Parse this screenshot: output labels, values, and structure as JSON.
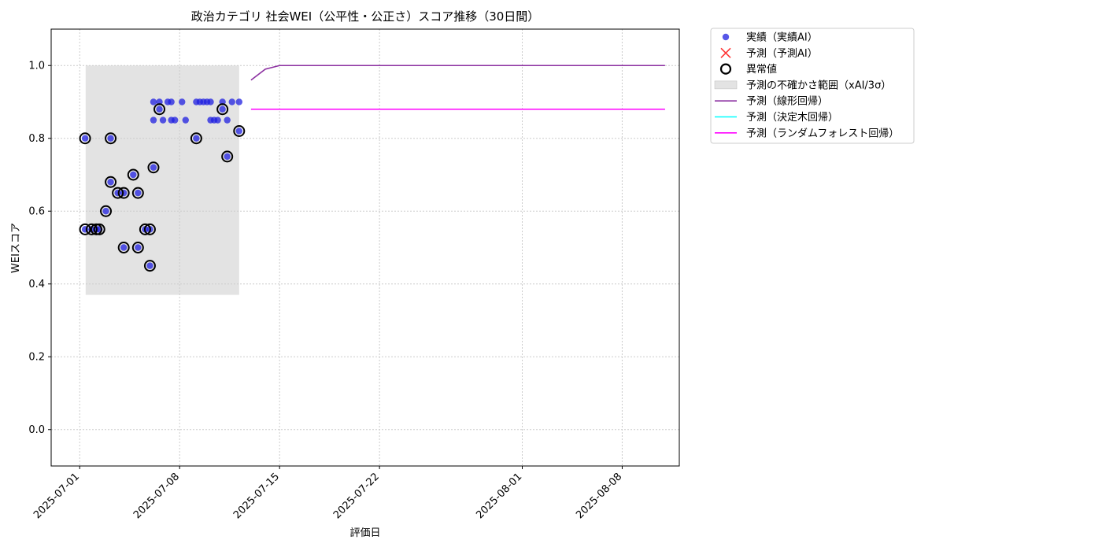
{
  "chart_data": {
    "type": "scatter",
    "title": "政治カテゴリ 社会WEI（公平性・公正さ）スコア推移（30日間）",
    "xlabel": "評価日",
    "ylabel": "WEIスコア",
    "xlim": [
      "2025-06-29",
      "2025-08-12"
    ],
    "ylim": [
      -0.1,
      1.1
    ],
    "x_ticks": [
      "2025-07-01",
      "2025-07-08",
      "2025-07-15",
      "2025-07-22",
      "2025-08-01",
      "2025-08-08"
    ],
    "y_ticks": [
      0.0,
      0.2,
      0.4,
      0.6,
      0.8,
      1.0
    ],
    "y_tick_labels": [
      "0.0",
      "0.2",
      "0.4",
      "0.6",
      "0.8",
      "1.0"
    ],
    "grid": true,
    "legend_position": "outside-upper-right",
    "uncertainty_band": {
      "x_start": "2025-07-01T10:00",
      "x_end": "2025-07-12T04:00",
      "y_low": 0.37,
      "y_high": 1.0,
      "color": "#cccccc"
    },
    "series": [
      {
        "name": "実績（実績AI）",
        "kind": "scatter",
        "color": "#1f1fe0",
        "points": [
          [
            "2025-07-01T09:00",
            0.8
          ],
          [
            "2025-07-01T09:00",
            0.55
          ],
          [
            "2025-07-01T20:00",
            0.55
          ],
          [
            "2025-07-02T04:00",
            0.55
          ],
          [
            "2025-07-02T09:00",
            0.55
          ],
          [
            "2025-07-02T20:00",
            0.6
          ],
          [
            "2025-07-03T04:00",
            0.8
          ],
          [
            "2025-07-03T04:00",
            0.68
          ],
          [
            "2025-07-03T16:00",
            0.65
          ],
          [
            "2025-07-04T02:00",
            0.65
          ],
          [
            "2025-07-04T02:00",
            0.5
          ],
          [
            "2025-07-04T18:00",
            0.7
          ],
          [
            "2025-07-05T02:00",
            0.65
          ],
          [
            "2025-07-05T02:00",
            0.5
          ],
          [
            "2025-07-05T14:00",
            0.55
          ],
          [
            "2025-07-05T22:00",
            0.55
          ],
          [
            "2025-07-05T22:00",
            0.45
          ],
          [
            "2025-07-06T04:00",
            0.72
          ],
          [
            "2025-07-06T04:00",
            0.9
          ],
          [
            "2025-07-06T04:00",
            0.85
          ],
          [
            "2025-07-06T14:00",
            0.88
          ],
          [
            "2025-07-06T14:00",
            0.9
          ],
          [
            "2025-07-06T20:00",
            0.85
          ],
          [
            "2025-07-07T04:00",
            0.9
          ],
          [
            "2025-07-07T10:00",
            0.85
          ],
          [
            "2025-07-07T10:00",
            0.9
          ],
          [
            "2025-07-07T16:00",
            0.85
          ],
          [
            "2025-07-08T04:00",
            0.9
          ],
          [
            "2025-07-08T10:00",
            0.85
          ],
          [
            "2025-07-09T04:00",
            0.9
          ],
          [
            "2025-07-09T04:00",
            0.8
          ],
          [
            "2025-07-09T10:00",
            0.9
          ],
          [
            "2025-07-09T16:00",
            0.9
          ],
          [
            "2025-07-09T22:00",
            0.9
          ],
          [
            "2025-07-10T04:00",
            0.9
          ],
          [
            "2025-07-10T04:00",
            0.85
          ],
          [
            "2025-07-10T10:00",
            0.85
          ],
          [
            "2025-07-10T16:00",
            0.85
          ],
          [
            "2025-07-11T00:00",
            0.88
          ],
          [
            "2025-07-11T00:00",
            0.9
          ],
          [
            "2025-07-11T08:00",
            0.85
          ],
          [
            "2025-07-11T08:00",
            0.75
          ],
          [
            "2025-07-11T16:00",
            0.9
          ],
          [
            "2025-07-12T04:00",
            0.9
          ],
          [
            "2025-07-12T04:00",
            0.82
          ]
        ]
      },
      {
        "name": "予測（予測AI）",
        "kind": "scatter-x",
        "color": "#ff0000",
        "points": []
      },
      {
        "name": "異常値",
        "kind": "ring",
        "color": "#000000",
        "points": [
          [
            "2025-07-01T09:00",
            0.8
          ],
          [
            "2025-07-01T09:00",
            0.55
          ],
          [
            "2025-07-01T20:00",
            0.55
          ],
          [
            "2025-07-02T04:00",
            0.55
          ],
          [
            "2025-07-02T09:00",
            0.55
          ],
          [
            "2025-07-02T20:00",
            0.6
          ],
          [
            "2025-07-03T04:00",
            0.8
          ],
          [
            "2025-07-03T04:00",
            0.68
          ],
          [
            "2025-07-03T16:00",
            0.65
          ],
          [
            "2025-07-04T02:00",
            0.65
          ],
          [
            "2025-07-04T02:00",
            0.5
          ],
          [
            "2025-07-04T18:00",
            0.7
          ],
          [
            "2025-07-05T02:00",
            0.65
          ],
          [
            "2025-07-05T02:00",
            0.5
          ],
          [
            "2025-07-05T14:00",
            0.55
          ],
          [
            "2025-07-05T22:00",
            0.55
          ],
          [
            "2025-07-05T22:00",
            0.45
          ],
          [
            "2025-07-06T04:00",
            0.72
          ],
          [
            "2025-07-06T14:00",
            0.88
          ],
          [
            "2025-07-09T04:00",
            0.8
          ],
          [
            "2025-07-11T00:00",
            0.88
          ],
          [
            "2025-07-11T08:00",
            0.75
          ],
          [
            "2025-07-12T04:00",
            0.82
          ]
        ]
      },
      {
        "name": "予測の不確かさ範囲（xAI/3σ）",
        "kind": "band",
        "color": "#cccccc"
      },
      {
        "name": "予測（線形回帰）",
        "kind": "line",
        "color": "#8b2fa0",
        "points": [
          [
            "2025-07-13",
            0.96
          ],
          [
            "2025-07-14",
            0.99
          ],
          [
            "2025-07-15",
            1.0
          ],
          [
            "2025-08-11",
            1.0
          ]
        ]
      },
      {
        "name": "予測（決定木回帰）",
        "kind": "line",
        "color": "#00ffff",
        "points": [
          [
            "2025-07-13",
            0.88
          ],
          [
            "2025-08-11",
            0.88
          ]
        ]
      },
      {
        "name": "予測（ランダムフォレスト回帰）",
        "kind": "line",
        "color": "#ff00ff",
        "points": [
          [
            "2025-07-13",
            0.88
          ],
          [
            "2025-08-11",
            0.88
          ]
        ]
      }
    ]
  }
}
